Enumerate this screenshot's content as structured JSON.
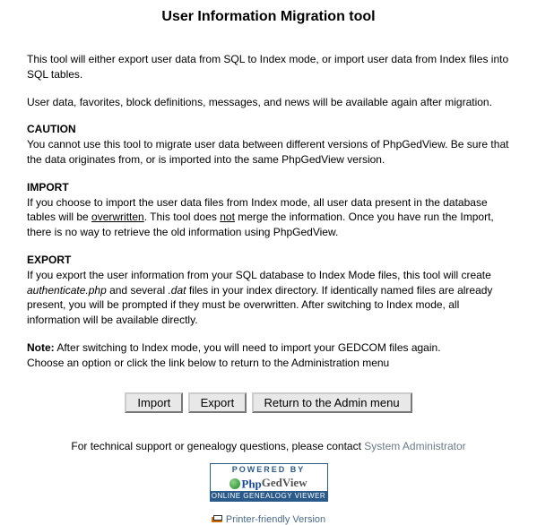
{
  "title": "User Information Migration tool",
  "intro": "This tool will either export user data from SQL to Index mode, or import user data from Index files into SQL tables.",
  "available": "User data, favorites, block definitions, messages, and news will be available again after migration.",
  "caution": {
    "heading": "CAUTION",
    "text": "You cannot use this tool to migrate user data between different versions of PhpGedView. Be sure that the data originates from, or is imported into the same PhpGedView version."
  },
  "importSection": {
    "heading": "IMPORT",
    "pre": "If you choose to import the user data files from Index mode, all user data present in the database tables will be ",
    "overwritten": "overwritten",
    "mid": ". This tool does ",
    "not": "not",
    "post": " merge the information. Once you have run the Import, there is no way to retrieve the old information using PhpGedView."
  },
  "exportSection": {
    "heading": "EXPORT",
    "pre": "If you export the user information from your SQL database to Index Mode files, this tool will create ",
    "auth": "authenticate.php",
    "mid1": " and several ",
    "dat": ".dat",
    "post": " files in your index directory. If identically named files are already present, you will be prompted if they must be overwritten. After switching to Index mode, all information will be available directly."
  },
  "note": {
    "label": "Note:",
    "text1": " After switching to Index mode, you will need to import your GEDCOM files again.",
    "text2": "Choose an option or click the link below to return to the Administration menu"
  },
  "buttons": {
    "import": "Import",
    "export": "Export",
    "return": "Return to the Admin menu"
  },
  "support": {
    "text": "For technical support or genealogy questions, please contact ",
    "link": "System Administrator"
  },
  "badge": {
    "top": "POWERED BY",
    "brand_pre": "Php",
    "brand_post": "GedView",
    "bottom": "ONLINE GENEALOGY VIEWER"
  },
  "printer": "Printer-friendly Version"
}
